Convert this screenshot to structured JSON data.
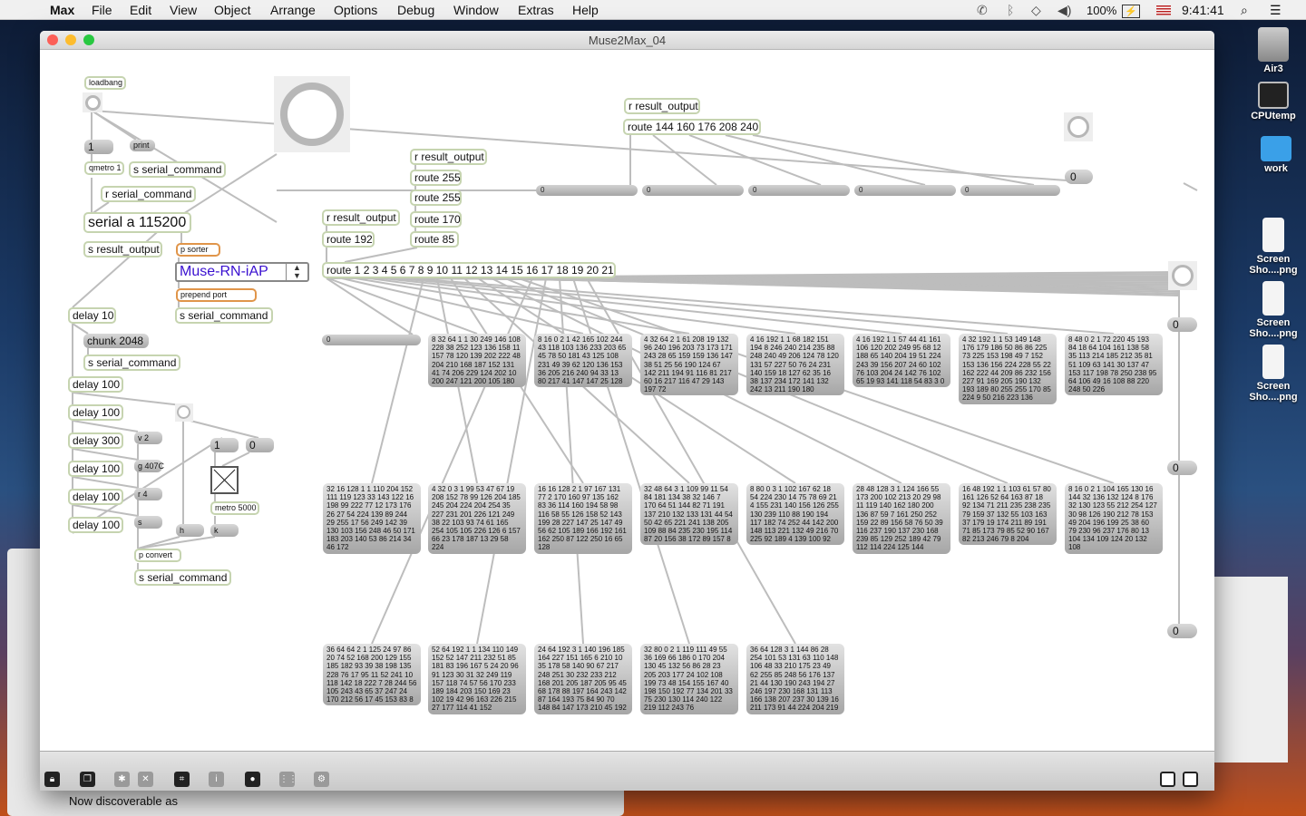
{
  "menubar": {
    "app": "Max",
    "items": [
      "File",
      "Edit",
      "View",
      "Object",
      "Arrange",
      "Options",
      "Debug",
      "Window",
      "Extras",
      "Help"
    ],
    "battery": "100%",
    "clock": "9:41:41"
  },
  "desktop": {
    "icons": [
      "Air3",
      "CPUtemp",
      "work",
      "Screen Sho....png",
      "Screen Sho....png",
      "Screen Sho....png"
    ]
  },
  "background_window": {
    "text": "Now discoverable as"
  },
  "window": {
    "title": "Muse2Max_04"
  },
  "patch": {
    "loadbang": "loadbang",
    "msg_1": "1",
    "print": "print",
    "qmetro": "qmetro 1",
    "s_serial_1": "s serial_command",
    "r_serial": "r serial_command",
    "serial": "serial a 115200",
    "s_result": "s result_output",
    "p_sorter": "p sorter",
    "umenu": "Muse-RN-iAP",
    "prepend": "prepend port",
    "s_serial_2": "s serial_command",
    "delay_10": "delay 10",
    "chunk": "chunk 2048",
    "s_serial_3": "s serial_command",
    "delays": [
      "delay 100",
      "delay 100",
      "delay 300",
      "delay 100",
      "delay 100",
      "delay 100"
    ],
    "msgs_small": [
      "v 2",
      "g 407C",
      "r 4",
      "s"
    ],
    "msg_one": "1",
    "msg_zero": "0",
    "metro": "metro 5000",
    "msg_h": "h",
    "msg_k": "k",
    "p_convert": "p convert",
    "s_serial_4": "s serial_command",
    "r_result_a": "r result_output",
    "route_ids": "route 144 160 176 208 240",
    "r_result_b": "r result_output",
    "route_255a": "route 255",
    "route_255b": "route 255",
    "route_170": "route 170",
    "route_85": "route 85",
    "r_result_c": "r result_output",
    "route_192": "route 192",
    "route_main": "route 1 2 3 4 5 6 7 8 9 10 11 12 13 14 15 16 17 18 19 20 21",
    "flonums": [
      "0",
      "0",
      "0",
      "0",
      "0"
    ],
    "num_top": "0",
    "num_left": "0",
    "num_right": [
      "0",
      "0",
      "0"
    ],
    "packets_row1": [
      "8 32 64 1 1 30 249 146 108 228 38 252 123 136 158 11 157 78 120 139 202 222 48 204 210 168 187 152 131 41 74 206 229 124 202 10 200 247 121 200 105 180",
      "8 16 0 2 1 42 165 102 244 43 118 103 136 233 203 65 45 78 50 181 43 125 108 231 49 39 62 120 136 153 36 205 216 240 94 33 13 80 217 41 147 147 25 128",
      "4 32 64 2 1 61 208 19 132 96 240 196 203 73 173 171 243 28 65 159 159 136 147 38 51 25 56 190 124 67 142 211 194 91 116 81 217 60 16 217 116 47 29 143 197 72",
      "4 16 192 1 1 68 182 151 194 8 246 240 214 235 88 248 240 49 206 124 78 120 131 57 227 50 76 24 231 140 159 18 127 62 35 16 38 137 234 172 141 132 242 13 211 190 180",
      "4 16 192 1 1 57 44 41 161 106 120 202 249 95 68 12 188 65 140 204 19 51 224 243 39 156 207 24 60 102 76 103 204 24 142 76 102 65 19 93 141 118 54 83 3 0",
      "4 32 192 1 1 53 149 148 176 179 186 50 86 86 225 73 225 153 198 49 7 152 153 136 156 224 228 55 22 162 222 44 209 86 232 156 227 91 169 205 190 132 193 189 80 255 255 170 85 224 9 50 216 223 136",
      "8 48 0 2 1 72 220 45 193 84 18 64 104 161 138 58 35 113 214 185 212 35 81 51 109 63 141 30 137 47 153 117 198 78 250 238 95 64 106 49 16 108 88 220 248 50 226"
    ],
    "packets_row2": [
      "32 16 128 1 1 110 204 152 111 119 123 33 143 122 16 198 99 222 77 12 173 176 26 27 54 224 139 89 244 29 255 17 56 249 142 39 130 103 156 248 46 50 171 183 203 140 53 86 214 34 46 172",
      "4 32 0 3 1 99 53 47 67 19 208 152 78 99 126 204 185 245 204 224 204 254 35 227 231 201 226 121 249 38 22 103 93 74 61 165 254 105 105 226 126 6 157 66 23 178 187 13 29 58 224",
      "16 16 128 2 1 97 167 131 77 2 170 160 97 135 162 83 36 114 160 194 58 98 116 58 55 126 158 52 143 199 28 227 147 25 147 49 56 62 105 189 166 192 161 162 250 87 122 250 16 65 128",
      "32 48 64 3 1 109 99 11 54 84 181 134 38 32 146 7 170 64 51 144 82 71 191 137 210 132 133 131 44 54 50 42 65 221 241 138 205 109 88 84 235 230 195 114 87 20 156 38 172 89 157 8",
      "8 80 0 3 1 102 167 62 18 54 224 230 14 75 78 69 21 4 155 231 140 156 126 255 130 239 110 88 190 194 117 182 74 252 44 142 200 148 113 221 132 49 216 70 225 92 189 4 139 100 92",
      "28 48 128 3 1 124 166 55 173 200 102 213 20 29 98 11 119 140 162 180 200 136 87 59 7 161 250 252 159 22 89 156 58 76 50 39 116 237 190 137 230 168 239 85 129 252 189 42 79 112 114 224 125 144",
      "16 48 192 1 1 103 61 57 80 161 126 52 64 163 87 18 92 134 71 211 235 238 235 79 159 37 132 55 103 163 37 179 19 174 211 89 191 71 85 173 79 85 52 90 167 82 213 246 79 8 204",
      "8 16 0 2 1 104 165 130 16 144 32 136 132 124 8 176 32 130 123 55 212 254 127 30 98 126 190 212 78 153 49 204 196 199 25 38 60 79 230 96 237 176 80 13 104 134 109 124 20 132 108"
    ],
    "packets_row3": [
      "36 64 64 2 1 125 24 97 86 20 74 52 168 200 129 155 185 182 93 39 38 198 135 228 76 17 95 11 52 241 10 118 142 18 222 7 28 244 56 105 243 43 65 37 247 24 170 212 56 17 45 153 83 8",
      "52 64 192 1 1 134 110 149 152 52 147 211 232 51 85 181 83 196 167 5 24 20 96 91 123 30 31 32 249 119 157 118 74 57 56 170 233 189 184 203 150 169 23 102 19 42 96 163 226 215 27 177 114 41 152",
      "24 64 192 3 1 140 196 185 164 227 151 165 6 210 10 35 178 58 140 90 67 217 248 251 30 232 233 212 168 201 205 187 205 95 45 68 178 88 197 164 243 142 87 164 193 75 84 90 70 148 84 147 173 210 45 192",
      "32 80 0 2 1 119 111 49 55 36 169 66 186 0 170 204 130 45 132 56 86 28 23 205 203 177 24 102 108 199 73 48 154 155 167 40 198 150 192 77 134 201 33 75 230 130 114 240 122 219 112 243 76",
      "36 64 128 3 1 144 86 28 254 101 53 131 63 110 148 106 48 33 210 175 23 49 62 255 85 248 56 176 137 21 44 130 190 243 194 27 246 197 230 168 131 113 166 138 207 237 30 139 16 211 173 91 44 224 204 219"
    ]
  },
  "toolbar": {
    "icons": [
      "lock-icon",
      "new-object-icon",
      "extras-icon",
      "clear-icon",
      "presentation-icon",
      "inspector-icon",
      "patch-cord-icon",
      "grid-icon",
      "snap-icon"
    ]
  },
  "colors": {
    "object_border": "#c6d4b0",
    "subpatch_border": "#e0954a",
    "umenu_text": "#3a10d0"
  }
}
